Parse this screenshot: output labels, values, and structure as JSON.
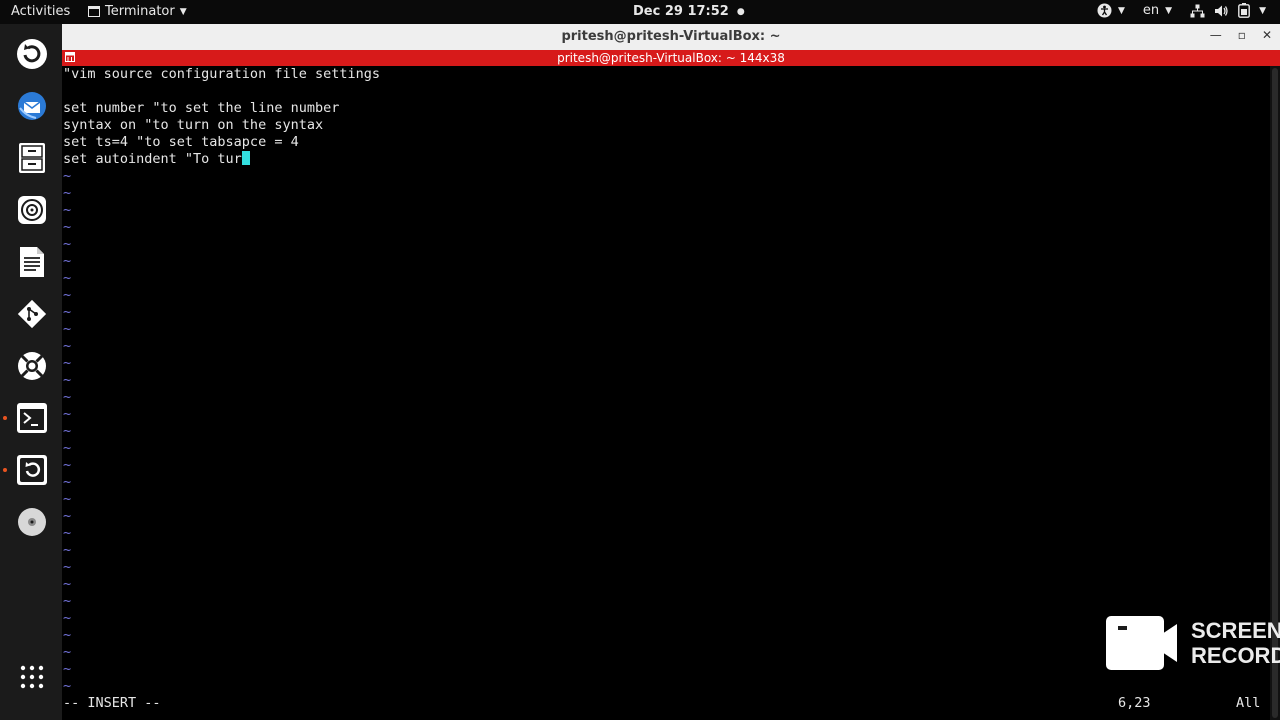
{
  "topbar": {
    "activities": "Activities",
    "app_name": "Terminator",
    "clock": "Dec 29  17:52",
    "clock_dot": "●",
    "lang": "en"
  },
  "window": {
    "title": "pritesh@pritesh-VirtualBox: ~",
    "terminal_title": "pritesh@pritesh-VirtualBox: ~ 144x38"
  },
  "editor": {
    "lines": [
      "\"vim source configuration file settings",
      "",
      "set number \"to set the line number",
      "syntax on \"to turn on the syntax",
      "set ts=4 \"to set tabsapce = 4",
      "set autoindent \"To tur"
    ],
    "tilde": "~",
    "mode": "-- INSERT --",
    "position": "6,23",
    "scroll": "All"
  },
  "watermark": {
    "text": "SCREEN\nRECORD"
  },
  "colors": {
    "terminal_header": "#d71a1a",
    "tilde": "#7272d9",
    "cursor": "#33e0e0",
    "accent": "#e95420"
  }
}
